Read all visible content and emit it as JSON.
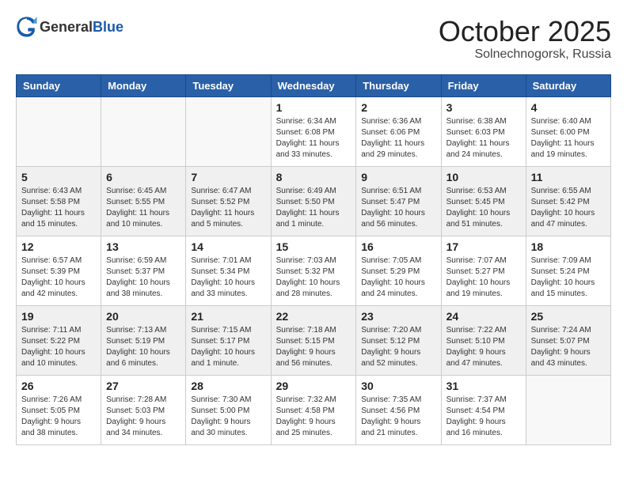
{
  "header": {
    "logo_general": "General",
    "logo_blue": "Blue",
    "month": "October 2025",
    "location": "Solnechnogorsk, Russia"
  },
  "days_of_week": [
    "Sunday",
    "Monday",
    "Tuesday",
    "Wednesday",
    "Thursday",
    "Friday",
    "Saturday"
  ],
  "weeks": [
    [
      {
        "day": "",
        "info": ""
      },
      {
        "day": "",
        "info": ""
      },
      {
        "day": "",
        "info": ""
      },
      {
        "day": "1",
        "info": "Sunrise: 6:34 AM\nSunset: 6:08 PM\nDaylight: 11 hours\nand 33 minutes."
      },
      {
        "day": "2",
        "info": "Sunrise: 6:36 AM\nSunset: 6:06 PM\nDaylight: 11 hours\nand 29 minutes."
      },
      {
        "day": "3",
        "info": "Sunrise: 6:38 AM\nSunset: 6:03 PM\nDaylight: 11 hours\nand 24 minutes."
      },
      {
        "day": "4",
        "info": "Sunrise: 6:40 AM\nSunset: 6:00 PM\nDaylight: 11 hours\nand 19 minutes."
      }
    ],
    [
      {
        "day": "5",
        "info": "Sunrise: 6:43 AM\nSunset: 5:58 PM\nDaylight: 11 hours\nand 15 minutes."
      },
      {
        "day": "6",
        "info": "Sunrise: 6:45 AM\nSunset: 5:55 PM\nDaylight: 11 hours\nand 10 minutes."
      },
      {
        "day": "7",
        "info": "Sunrise: 6:47 AM\nSunset: 5:52 PM\nDaylight: 11 hours\nand 5 minutes."
      },
      {
        "day": "8",
        "info": "Sunrise: 6:49 AM\nSunset: 5:50 PM\nDaylight: 11 hours\nand 1 minute."
      },
      {
        "day": "9",
        "info": "Sunrise: 6:51 AM\nSunset: 5:47 PM\nDaylight: 10 hours\nand 56 minutes."
      },
      {
        "day": "10",
        "info": "Sunrise: 6:53 AM\nSunset: 5:45 PM\nDaylight: 10 hours\nand 51 minutes."
      },
      {
        "day": "11",
        "info": "Sunrise: 6:55 AM\nSunset: 5:42 PM\nDaylight: 10 hours\nand 47 minutes."
      }
    ],
    [
      {
        "day": "12",
        "info": "Sunrise: 6:57 AM\nSunset: 5:39 PM\nDaylight: 10 hours\nand 42 minutes."
      },
      {
        "day": "13",
        "info": "Sunrise: 6:59 AM\nSunset: 5:37 PM\nDaylight: 10 hours\nand 38 minutes."
      },
      {
        "day": "14",
        "info": "Sunrise: 7:01 AM\nSunset: 5:34 PM\nDaylight: 10 hours\nand 33 minutes."
      },
      {
        "day": "15",
        "info": "Sunrise: 7:03 AM\nSunset: 5:32 PM\nDaylight: 10 hours\nand 28 minutes."
      },
      {
        "day": "16",
        "info": "Sunrise: 7:05 AM\nSunset: 5:29 PM\nDaylight: 10 hours\nand 24 minutes."
      },
      {
        "day": "17",
        "info": "Sunrise: 7:07 AM\nSunset: 5:27 PM\nDaylight: 10 hours\nand 19 minutes."
      },
      {
        "day": "18",
        "info": "Sunrise: 7:09 AM\nSunset: 5:24 PM\nDaylight: 10 hours\nand 15 minutes."
      }
    ],
    [
      {
        "day": "19",
        "info": "Sunrise: 7:11 AM\nSunset: 5:22 PM\nDaylight: 10 hours\nand 10 minutes."
      },
      {
        "day": "20",
        "info": "Sunrise: 7:13 AM\nSunset: 5:19 PM\nDaylight: 10 hours\nand 6 minutes."
      },
      {
        "day": "21",
        "info": "Sunrise: 7:15 AM\nSunset: 5:17 PM\nDaylight: 10 hours\nand 1 minute."
      },
      {
        "day": "22",
        "info": "Sunrise: 7:18 AM\nSunset: 5:15 PM\nDaylight: 9 hours\nand 56 minutes."
      },
      {
        "day": "23",
        "info": "Sunrise: 7:20 AM\nSunset: 5:12 PM\nDaylight: 9 hours\nand 52 minutes."
      },
      {
        "day": "24",
        "info": "Sunrise: 7:22 AM\nSunset: 5:10 PM\nDaylight: 9 hours\nand 47 minutes."
      },
      {
        "day": "25",
        "info": "Sunrise: 7:24 AM\nSunset: 5:07 PM\nDaylight: 9 hours\nand 43 minutes."
      }
    ],
    [
      {
        "day": "26",
        "info": "Sunrise: 7:26 AM\nSunset: 5:05 PM\nDaylight: 9 hours\nand 38 minutes."
      },
      {
        "day": "27",
        "info": "Sunrise: 7:28 AM\nSunset: 5:03 PM\nDaylight: 9 hours\nand 34 minutes."
      },
      {
        "day": "28",
        "info": "Sunrise: 7:30 AM\nSunset: 5:00 PM\nDaylight: 9 hours\nand 30 minutes."
      },
      {
        "day": "29",
        "info": "Sunrise: 7:32 AM\nSunset: 4:58 PM\nDaylight: 9 hours\nand 25 minutes."
      },
      {
        "day": "30",
        "info": "Sunrise: 7:35 AM\nSunset: 4:56 PM\nDaylight: 9 hours\nand 21 minutes."
      },
      {
        "day": "31",
        "info": "Sunrise: 7:37 AM\nSunset: 4:54 PM\nDaylight: 9 hours\nand 16 minutes."
      },
      {
        "day": "",
        "info": ""
      }
    ]
  ]
}
